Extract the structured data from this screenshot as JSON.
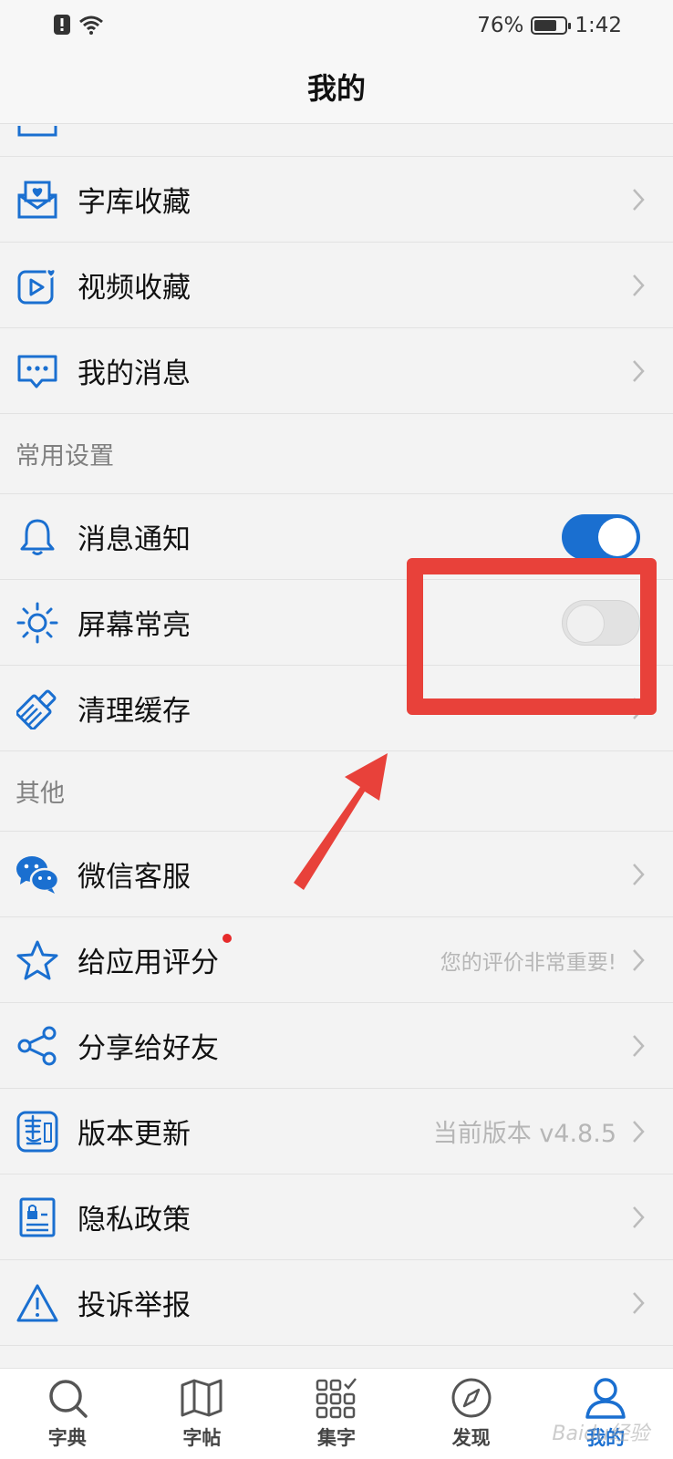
{
  "status": {
    "battery": "76%",
    "battery_level": 0.76,
    "time": "1:42"
  },
  "header": {
    "title": "我的"
  },
  "rows_top": [
    {
      "id": "font-library",
      "label": "字库收藏",
      "icon": "envelope-heart-icon"
    },
    {
      "id": "video",
      "label": "视频收藏",
      "icon": "video-heart-icon"
    },
    {
      "id": "messages",
      "label": "我的消息",
      "icon": "chat-bubble-icon"
    }
  ],
  "section_common": "常用设置",
  "settings": {
    "notify": {
      "label": "消息通知",
      "on": true
    },
    "screen": {
      "label": "屏幕常亮",
      "on": false
    },
    "cache": {
      "label": "清理缓存"
    }
  },
  "section_other": "其他",
  "rows_other": {
    "wechat": {
      "label": "微信客服"
    },
    "rate": {
      "label": "给应用评分",
      "hint": "您的评价非常重要!"
    },
    "share": {
      "label": "分享给好友"
    },
    "version": {
      "label": "版本更新",
      "hint": "当前版本 v4.8.5"
    },
    "privacy": {
      "label": "隐私政策"
    },
    "report": {
      "label": "投诉举报"
    }
  },
  "tabs": [
    {
      "label": "字典",
      "icon": "search-icon"
    },
    {
      "label": "字帖",
      "icon": "map-icon"
    },
    {
      "label": "集字",
      "icon": "grid-check-icon"
    },
    {
      "label": "发现",
      "icon": "compass-icon"
    },
    {
      "label": "我的",
      "icon": "user-icon",
      "active": true
    }
  ],
  "watermark": "Baidu经验",
  "colors": {
    "accent": "#1a6fd0",
    "annotation": "#e8413a",
    "red_dot": "#e62a2a"
  }
}
